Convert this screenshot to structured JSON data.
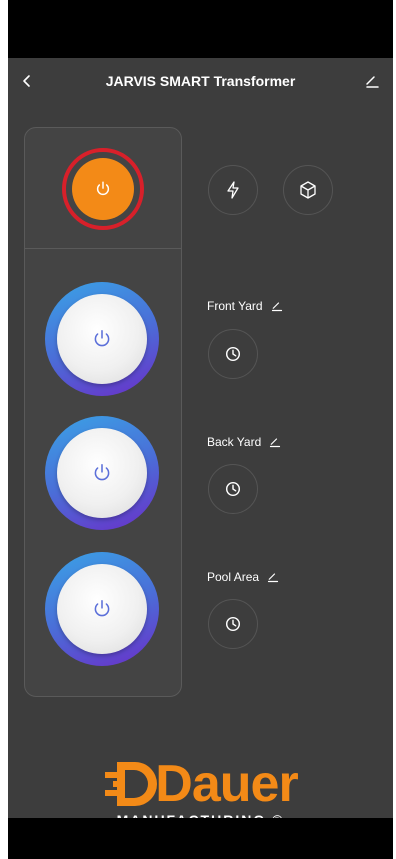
{
  "header": {
    "title": "JARVIS SMART Transformer",
    "back_icon": "chevron-left-icon",
    "edit_icon": "pencil-icon"
  },
  "master": {
    "icon": "power-icon",
    "state_color": "#f38a17",
    "highlight_color": "#d8202a"
  },
  "quick_actions": [
    {
      "icon": "lightning-icon"
    },
    {
      "icon": "cube-icon"
    }
  ],
  "zones": [
    {
      "label": "Front Yard",
      "power_icon": "power-icon",
      "timer_icon": "clock-icon",
      "edit_icon": "pencil-icon"
    },
    {
      "label": "Back Yard",
      "power_icon": "power-icon",
      "timer_icon": "clock-icon",
      "edit_icon": "pencil-icon"
    },
    {
      "label": "Pool Area",
      "power_icon": "power-icon",
      "timer_icon": "clock-icon",
      "edit_icon": "pencil-icon"
    }
  ],
  "brand": {
    "name": "Dauer",
    "tagline": "MANUFACTURING ®",
    "color": "#f38a17"
  }
}
